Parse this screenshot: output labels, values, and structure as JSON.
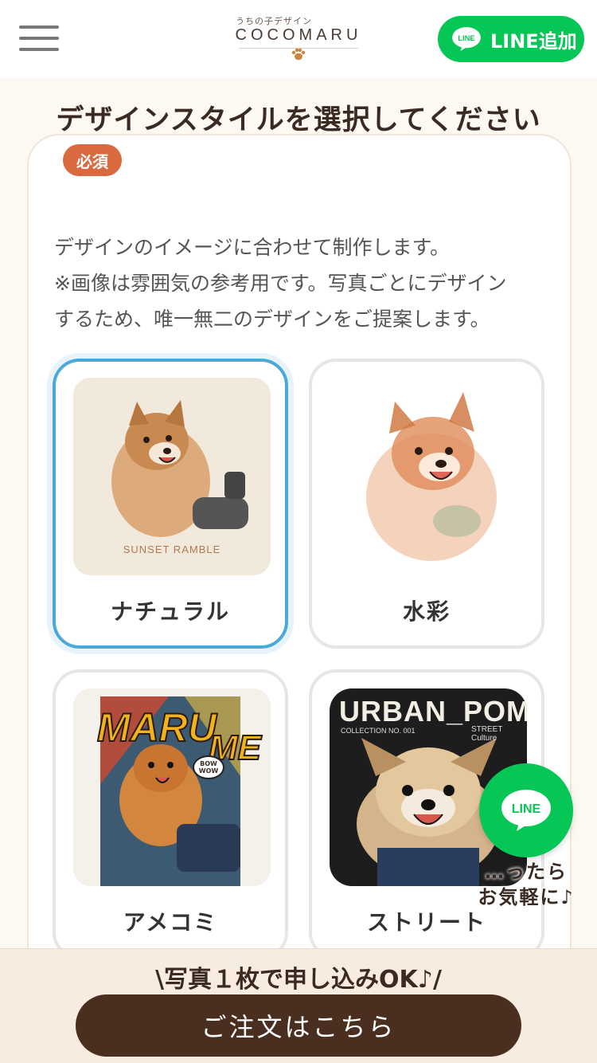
{
  "header": {
    "logo_sub": "うちの子デザイン",
    "logo_main": "COCOMARU",
    "line_button_badge": "LINE",
    "line_button_label": "LINE追加"
  },
  "section": {
    "title": "デザインスタイルを選択してください",
    "required_badge": "必須",
    "description": [
      "デザインのイメージに合わせて制作します。",
      "※画像は雰囲気の参考用です。写真ごとにデザイン",
      "するため、唯一無二のデザインをご提案します。"
    ]
  },
  "styles": [
    {
      "label": "ナチュラル",
      "selected": true,
      "image_caption": "SUNSET RAMBLE"
    },
    {
      "label": "水彩",
      "selected": false
    },
    {
      "label": "アメコミ",
      "selected": false,
      "image_text_1": "MARU",
      "image_text_2": "ME",
      "image_bubble": "BOW WOW"
    },
    {
      "label": "ストリート",
      "selected": false,
      "image_title": "URBAN_POM",
      "image_sub_1": "COLLECTION NO. 001",
      "image_sub_2": "STREET Culture"
    }
  ],
  "floating_line": {
    "badge": "LINE",
    "text_line1": "…ったら",
    "text_line2": "お気軽に♪"
  },
  "footer": {
    "promo": "\\写真１枚で申し込みOK♪/",
    "order_button": "ご注文はこちら"
  },
  "colors": {
    "line_green": "#06c755",
    "accent_orange": "#d9693f",
    "selected_blue": "#4aa9d8",
    "dark_brown": "#4a2e1f"
  }
}
